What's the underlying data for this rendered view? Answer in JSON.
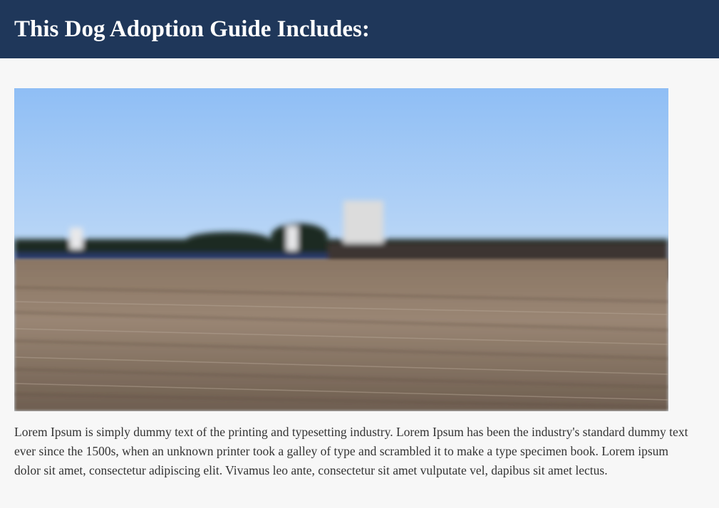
{
  "header": {
    "title": "This Dog Adoption Guide Includes:"
  },
  "main": {
    "image": {
      "icon": "blurred-pier-photo"
    },
    "paragraph": "Lorem Ipsum is simply dummy text of the printing and typesetting industry. Lorem Ipsum has been the industry's standard dummy text ever since the 1500s, when an unknown printer took a galley of type and scrambled it to make a type specimen book. Lorem ipsum dolor sit amet, consectetur adipiscing elit. Vivamus leo ante, consectetur sit amet vulputate vel, dapibus sit amet lectus."
  },
  "colors": {
    "header_bg": "#1f375a",
    "page_bg": "#f7f7f7",
    "text": "#333333"
  }
}
